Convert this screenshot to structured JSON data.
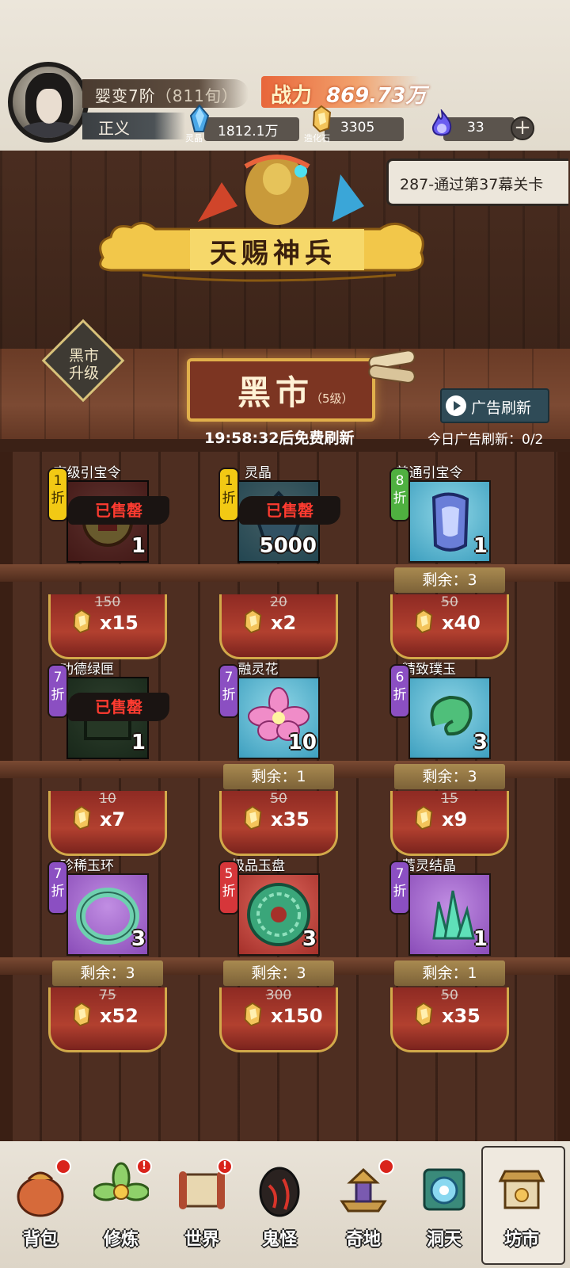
{
  "player": {
    "realm": "婴变7阶",
    "realm_sub": "（811旬）",
    "title": "正义",
    "power_label": "战力",
    "power_value": "869.73万"
  },
  "resources": [
    {
      "icon": "spirit-crystal-icon",
      "caption": "灵晶",
      "value": "1812.1万"
    },
    {
      "icon": "creation-stone-icon",
      "caption": "造化石",
      "value": "3305"
    },
    {
      "icon": "purple-flame-icon",
      "caption": "",
      "value": "33"
    }
  ],
  "quest": {
    "text": "287-通过第37幕关卡"
  },
  "banner": {
    "text": "天赐神兵"
  },
  "market": {
    "upgrade_label": "黑市升级",
    "name": "黑市",
    "level": "（5级）",
    "ad_button": "广告刷新",
    "refresh_timer": "19:58:32后免费刷新",
    "ad_count": "今日广告刷新：0/2"
  },
  "items": [
    {
      "name": "高级引宝令",
      "discount": "1折",
      "disc_color": "yellow",
      "bg": "red",
      "qty": "1",
      "sold": true,
      "sold_label": "已售罄",
      "stock": "",
      "old_price": "150",
      "price": "x15",
      "icon": "treasure-token-icon"
    },
    {
      "name": "灵晶",
      "discount": "1折",
      "disc_color": "yellow",
      "bg": "teal",
      "qty": "5000",
      "sold": true,
      "sold_label": "已售罄",
      "stock": "",
      "old_price": "20",
      "price": "x2",
      "icon": "spirit-crystal-icon"
    },
    {
      "name": "普通引宝令",
      "discount": "8折",
      "disc_color": "green",
      "bg": "teal",
      "qty": "1",
      "sold": false,
      "sold_label": "",
      "stock": "剩余：3",
      "old_price": "50",
      "price": "x40",
      "icon": "token-icon"
    },
    {
      "name": "功德绿匣",
      "discount": "7折",
      "disc_color": "purple",
      "bg": "green",
      "qty": "1",
      "sold": true,
      "sold_label": "已售罄",
      "stock": "",
      "old_price": "10",
      "price": "x7",
      "icon": "green-box-icon"
    },
    {
      "name": "融灵花",
      "discount": "7折",
      "disc_color": "purple",
      "bg": "teal",
      "qty": "10",
      "sold": false,
      "sold_label": "",
      "stock": "剩余：1",
      "old_price": "50",
      "price": "x35",
      "icon": "flower-icon"
    },
    {
      "name": "精致璞玉",
      "discount": "6折",
      "disc_color": "purple",
      "bg": "teal",
      "qty": "3",
      "sold": false,
      "sold_label": "",
      "stock": "剩余：3",
      "old_price": "15",
      "price": "x9",
      "icon": "jade-icon"
    },
    {
      "name": "珍稀玉环",
      "discount": "7折",
      "disc_color": "purple",
      "bg": "purple",
      "qty": "3",
      "sold": false,
      "sold_label": "",
      "stock": "剩余：3",
      "old_price": "75",
      "price": "x52",
      "icon": "jade-ring-icon"
    },
    {
      "name": "极品玉盘",
      "discount": "5折",
      "disc_color": "red",
      "bg": "red",
      "qty": "3",
      "sold": false,
      "sold_label": "",
      "stock": "剩余：3",
      "old_price": "300",
      "price": "x150",
      "icon": "jade-disc-icon"
    },
    {
      "name": "蓄灵结晶",
      "discount": "7折",
      "disc_color": "purple",
      "bg": "purple",
      "qty": "1",
      "sold": false,
      "sold_label": "",
      "stock": "剩余：1",
      "old_price": "50",
      "price": "x35",
      "icon": "crystal-cluster-icon"
    }
  ],
  "nav": [
    {
      "label": "背包",
      "icon": "bag-icon",
      "badge": "dot",
      "active": false
    },
    {
      "label": "修炼",
      "icon": "lotus-icon",
      "badge": "!",
      "active": false
    },
    {
      "label": "世界",
      "icon": "scroll-map-icon",
      "badge": "!",
      "active": false
    },
    {
      "label": "鬼怪",
      "icon": "ghost-egg-icon",
      "badge": "",
      "active": false
    },
    {
      "label": "奇地",
      "icon": "pagoda-icon",
      "badge": "dot",
      "active": false
    },
    {
      "label": "洞天",
      "icon": "portal-icon",
      "badge": "",
      "active": false
    },
    {
      "label": "坊市",
      "icon": "market-stall-icon",
      "badge": "",
      "active": true
    }
  ],
  "colors": {
    "accent": "#e1b04b",
    "sold": "#ff3b30",
    "wood": "#4a2a1d"
  }
}
